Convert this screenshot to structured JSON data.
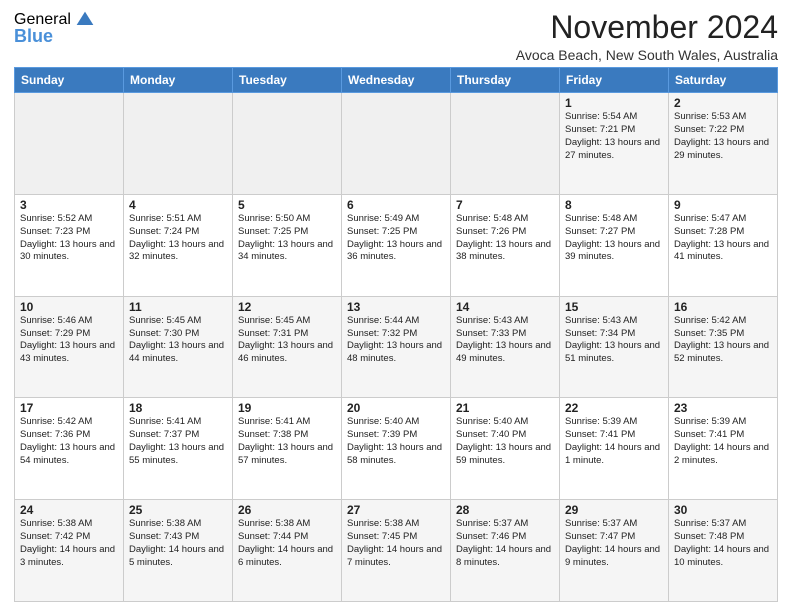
{
  "logo": {
    "general": "General",
    "blue": "Blue"
  },
  "title": "November 2024",
  "location": "Avoca Beach, New South Wales, Australia",
  "days_of_week": [
    "Sunday",
    "Monday",
    "Tuesday",
    "Wednesday",
    "Thursday",
    "Friday",
    "Saturday"
  ],
  "weeks": [
    [
      {
        "day": "",
        "info": ""
      },
      {
        "day": "",
        "info": ""
      },
      {
        "day": "",
        "info": ""
      },
      {
        "day": "",
        "info": ""
      },
      {
        "day": "",
        "info": ""
      },
      {
        "day": "1",
        "info": "Sunrise: 5:54 AM\nSunset: 7:21 PM\nDaylight: 13 hours and 27 minutes."
      },
      {
        "day": "2",
        "info": "Sunrise: 5:53 AM\nSunset: 7:22 PM\nDaylight: 13 hours and 29 minutes."
      }
    ],
    [
      {
        "day": "3",
        "info": "Sunrise: 5:52 AM\nSunset: 7:23 PM\nDaylight: 13 hours and 30 minutes."
      },
      {
        "day": "4",
        "info": "Sunrise: 5:51 AM\nSunset: 7:24 PM\nDaylight: 13 hours and 32 minutes."
      },
      {
        "day": "5",
        "info": "Sunrise: 5:50 AM\nSunset: 7:25 PM\nDaylight: 13 hours and 34 minutes."
      },
      {
        "day": "6",
        "info": "Sunrise: 5:49 AM\nSunset: 7:25 PM\nDaylight: 13 hours and 36 minutes."
      },
      {
        "day": "7",
        "info": "Sunrise: 5:48 AM\nSunset: 7:26 PM\nDaylight: 13 hours and 38 minutes."
      },
      {
        "day": "8",
        "info": "Sunrise: 5:48 AM\nSunset: 7:27 PM\nDaylight: 13 hours and 39 minutes."
      },
      {
        "day": "9",
        "info": "Sunrise: 5:47 AM\nSunset: 7:28 PM\nDaylight: 13 hours and 41 minutes."
      }
    ],
    [
      {
        "day": "10",
        "info": "Sunrise: 5:46 AM\nSunset: 7:29 PM\nDaylight: 13 hours and 43 minutes."
      },
      {
        "day": "11",
        "info": "Sunrise: 5:45 AM\nSunset: 7:30 PM\nDaylight: 13 hours and 44 minutes."
      },
      {
        "day": "12",
        "info": "Sunrise: 5:45 AM\nSunset: 7:31 PM\nDaylight: 13 hours and 46 minutes."
      },
      {
        "day": "13",
        "info": "Sunrise: 5:44 AM\nSunset: 7:32 PM\nDaylight: 13 hours and 48 minutes."
      },
      {
        "day": "14",
        "info": "Sunrise: 5:43 AM\nSunset: 7:33 PM\nDaylight: 13 hours and 49 minutes."
      },
      {
        "day": "15",
        "info": "Sunrise: 5:43 AM\nSunset: 7:34 PM\nDaylight: 13 hours and 51 minutes."
      },
      {
        "day": "16",
        "info": "Sunrise: 5:42 AM\nSunset: 7:35 PM\nDaylight: 13 hours and 52 minutes."
      }
    ],
    [
      {
        "day": "17",
        "info": "Sunrise: 5:42 AM\nSunset: 7:36 PM\nDaylight: 13 hours and 54 minutes."
      },
      {
        "day": "18",
        "info": "Sunrise: 5:41 AM\nSunset: 7:37 PM\nDaylight: 13 hours and 55 minutes."
      },
      {
        "day": "19",
        "info": "Sunrise: 5:41 AM\nSunset: 7:38 PM\nDaylight: 13 hours and 57 minutes."
      },
      {
        "day": "20",
        "info": "Sunrise: 5:40 AM\nSunset: 7:39 PM\nDaylight: 13 hours and 58 minutes."
      },
      {
        "day": "21",
        "info": "Sunrise: 5:40 AM\nSunset: 7:40 PM\nDaylight: 13 hours and 59 minutes."
      },
      {
        "day": "22",
        "info": "Sunrise: 5:39 AM\nSunset: 7:41 PM\nDaylight: 14 hours and 1 minute."
      },
      {
        "day": "23",
        "info": "Sunrise: 5:39 AM\nSunset: 7:41 PM\nDaylight: 14 hours and 2 minutes."
      }
    ],
    [
      {
        "day": "24",
        "info": "Sunrise: 5:38 AM\nSunset: 7:42 PM\nDaylight: 14 hours and 3 minutes."
      },
      {
        "day": "25",
        "info": "Sunrise: 5:38 AM\nSunset: 7:43 PM\nDaylight: 14 hours and 5 minutes."
      },
      {
        "day": "26",
        "info": "Sunrise: 5:38 AM\nSunset: 7:44 PM\nDaylight: 14 hours and 6 minutes."
      },
      {
        "day": "27",
        "info": "Sunrise: 5:38 AM\nSunset: 7:45 PM\nDaylight: 14 hours and 7 minutes."
      },
      {
        "day": "28",
        "info": "Sunrise: 5:37 AM\nSunset: 7:46 PM\nDaylight: 14 hours and 8 minutes."
      },
      {
        "day": "29",
        "info": "Sunrise: 5:37 AM\nSunset: 7:47 PM\nDaylight: 14 hours and 9 minutes."
      },
      {
        "day": "30",
        "info": "Sunrise: 5:37 AM\nSunset: 7:48 PM\nDaylight: 14 hours and 10 minutes."
      }
    ]
  ]
}
